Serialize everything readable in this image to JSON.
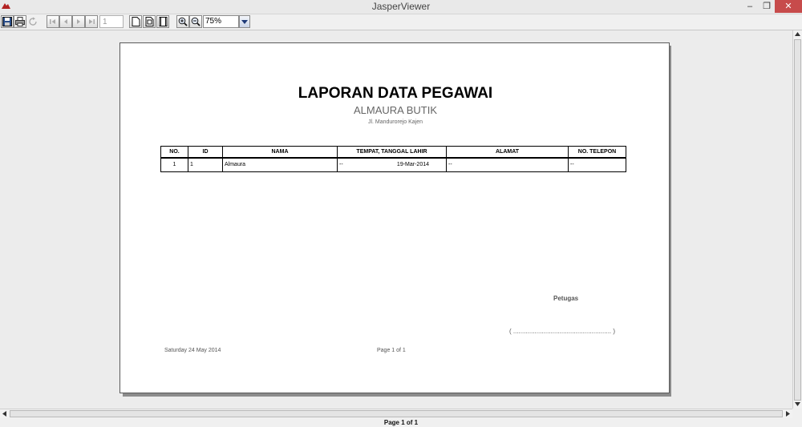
{
  "window": {
    "title": "JasperViewer",
    "minimize": "–",
    "maximize": "❐",
    "close": "✕"
  },
  "toolbar": {
    "page_number": "1",
    "zoom": "75%"
  },
  "report": {
    "title": "LAPORAN DATA PEGAWAI",
    "subtitle": "ALMAURA BUTIK",
    "address": "Jl. Mandurorejo Kajen",
    "columns": [
      "NO.",
      "ID",
      "NAMA",
      "TEMPAT, TANGGAL LAHIR",
      "ALAMAT",
      "NO. TELEPON"
    ],
    "rows": [
      {
        "no": "1",
        "id": "1",
        "nama": "Almaura",
        "tempat": "--",
        "tanggal": "19-Mar-2014",
        "alamat": "--",
        "telepon": "--"
      }
    ],
    "petugas_label": "Petugas",
    "signature_line": "( ....................................................... )",
    "footer_date": "Saturday 24 May 2014",
    "footer_page": "Page 1 of    1"
  },
  "status": {
    "page_info": "Page 1 of 1"
  }
}
